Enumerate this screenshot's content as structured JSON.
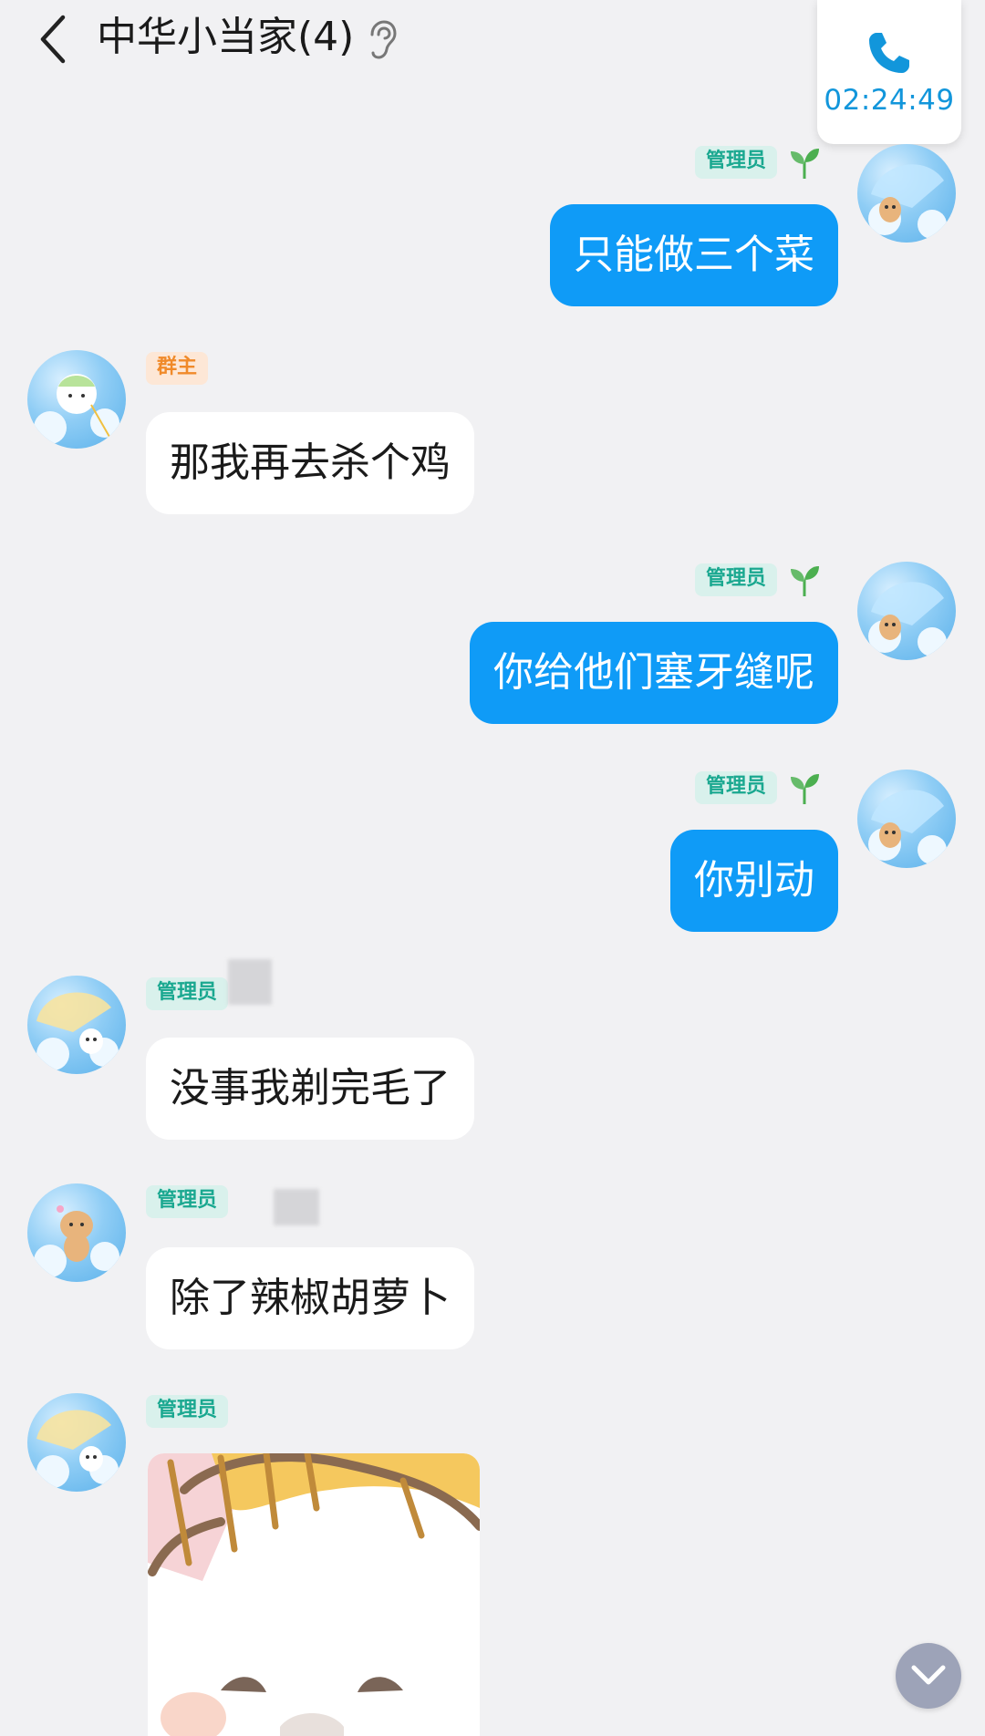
{
  "header": {
    "title": "中华小当家(4)",
    "call_timer": "02:24:49"
  },
  "messages": [
    {
      "side": "right",
      "badge": "管理员",
      "text": "只能做三个菜"
    },
    {
      "side": "left",
      "badge": "群主",
      "text": "那我再去杀个鸡"
    },
    {
      "side": "right",
      "badge": "管理员",
      "text": "你给他们塞牙缝呢"
    },
    {
      "side": "right",
      "badge": "管理员",
      "text": "你别动"
    },
    {
      "side": "left",
      "badge": "管理员",
      "text": "没事我剃完毛了"
    },
    {
      "side": "left",
      "badge": "管理员",
      "text": "除了辣椒胡萝卜"
    },
    {
      "side": "left",
      "badge": "管理员",
      "text": ""
    }
  ],
  "icons": {
    "back": "chevron-left-icon",
    "ear": "ear-icon",
    "phone": "phone-icon",
    "sprout": "sprout-icon",
    "scroll": "chevron-down-icon"
  },
  "colors": {
    "background": "#f1f1f3",
    "self_bubble": "#0f9bf7",
    "other_bubble": "#ffffff",
    "admin_badge_text": "#1aa890",
    "owner_badge_text": "#f08a2a",
    "call_timer": "#1296db"
  }
}
